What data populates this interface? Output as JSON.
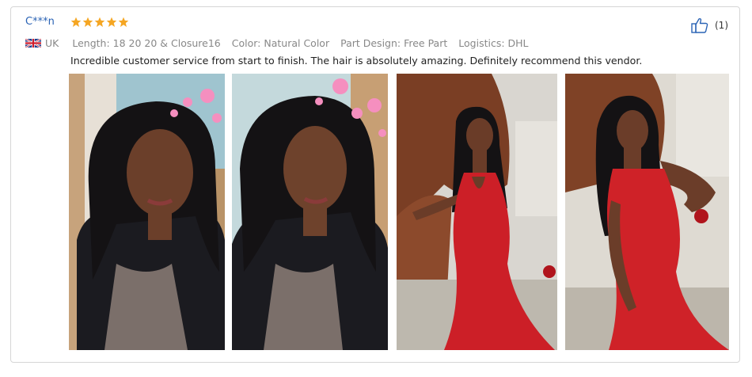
{
  "review": {
    "reviewer_name": "C***n",
    "rating": 5,
    "star_color": "#f5a623",
    "country_flag_icon": "uk-flag-icon",
    "country": "UK",
    "attributes": [
      "Length: 18 20 20 & Closure16",
      "Color: Natural Color",
      "Part Design: Free Part",
      "Logistics: DHL"
    ],
    "text": "Incredible customer service from start to finish. The hair is absolutely amazing. Definitely recommend this vendor.",
    "helpful_icon": "thumbs-up-icon",
    "helpful_count": "(1)",
    "photos": [
      {
        "icon": "review-photo-1"
      },
      {
        "icon": "review-photo-2"
      },
      {
        "icon": "review-photo-3"
      },
      {
        "icon": "review-photo-4"
      }
    ]
  }
}
